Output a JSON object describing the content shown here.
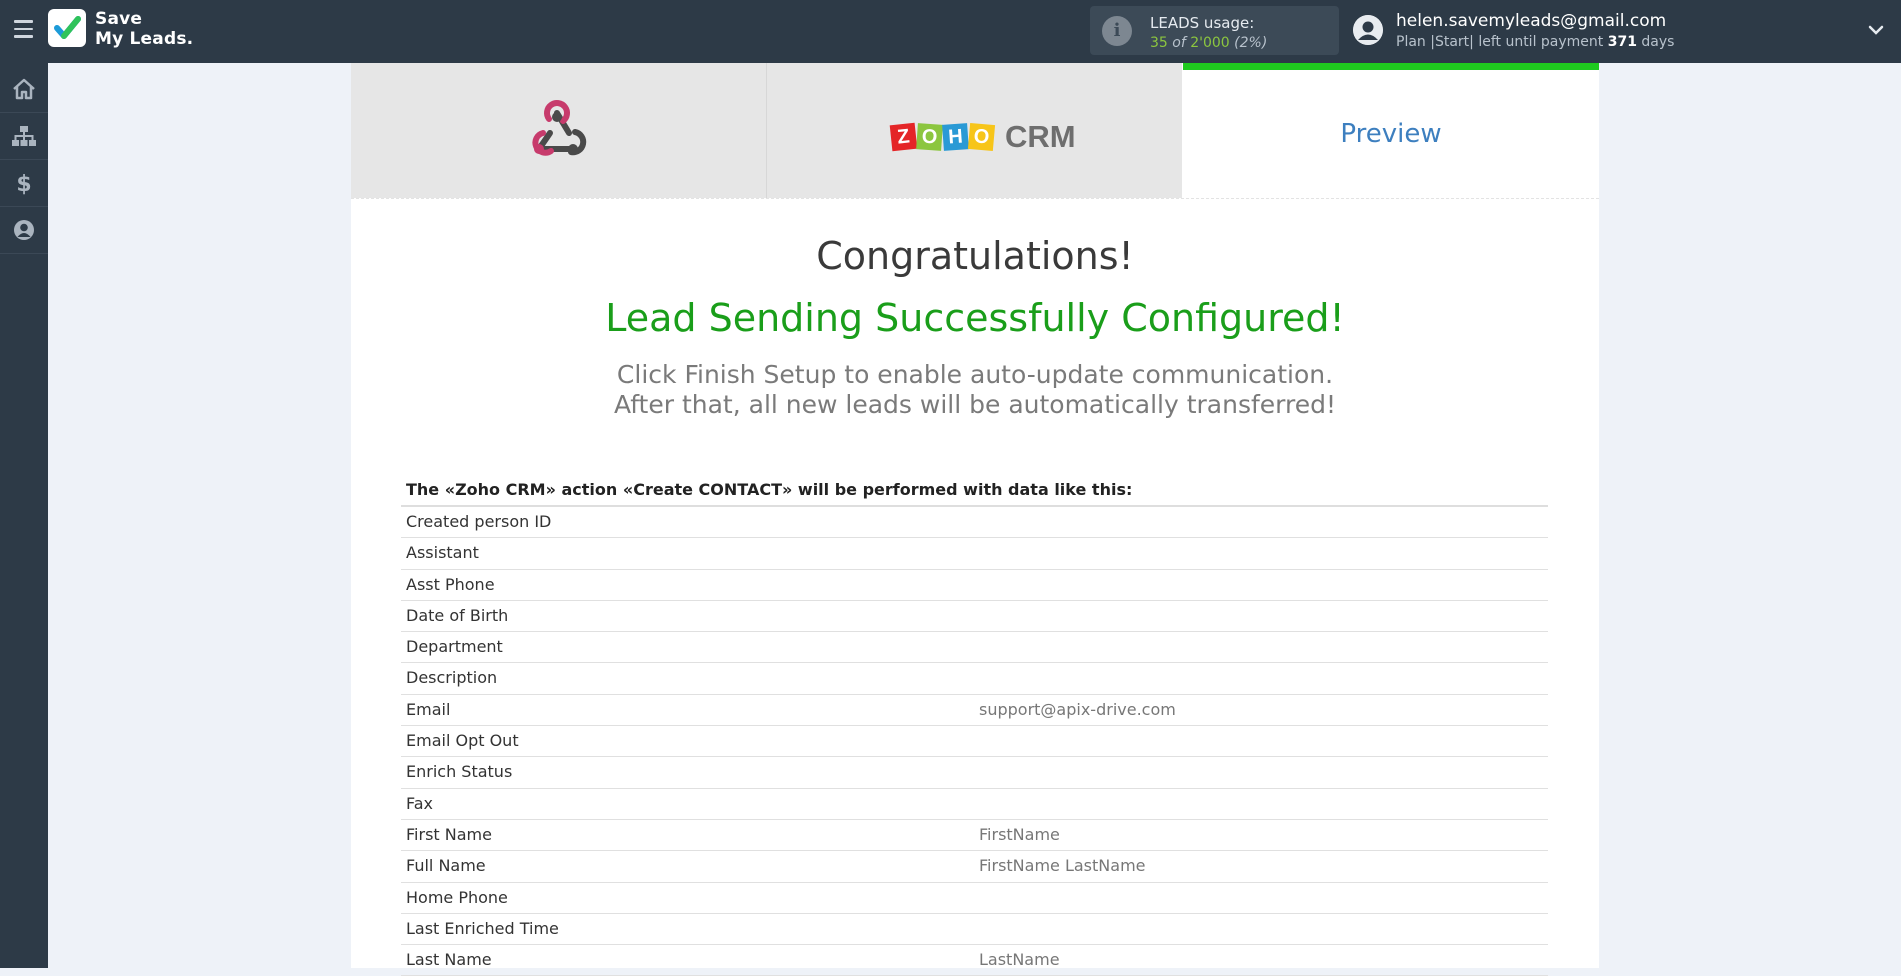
{
  "brand": {
    "name_line1": "Save",
    "name_line2": "My Leads."
  },
  "usage": {
    "title": "LEADS usage:",
    "used": "35",
    "of": "of",
    "total": "2'000",
    "percent": "(2%)"
  },
  "account": {
    "email": "helen.savemyleads@gmail.com",
    "plan_prefix": "Plan |Start| left until payment",
    "days_left": "371",
    "days_suffix": "days"
  },
  "sidebar": {
    "items": [
      "home-icon",
      "sitemap-icon",
      "dollar-icon",
      "user-icon"
    ]
  },
  "steps": {
    "tab2_label": "CRM",
    "tab3_label": "Preview"
  },
  "zoho_letters": [
    "Z",
    "O",
    "H",
    "O"
  ],
  "content": {
    "congrats": "Congratulations!",
    "success": "Lead Sending Successfully Configured!",
    "sub_line1": "Click Finish Setup to enable auto-update communication.",
    "sub_line2": "After that, all new leads will be automatically transferred!"
  },
  "table": {
    "header": "The «Zoho CRM» action «Create CONTACT» will be performed with data like this:",
    "rows": [
      {
        "field": "Created person ID",
        "value": ""
      },
      {
        "field": "Assistant",
        "value": ""
      },
      {
        "field": "Asst Phone",
        "value": ""
      },
      {
        "field": "Date of Birth",
        "value": ""
      },
      {
        "field": "Department",
        "value": ""
      },
      {
        "field": "Description",
        "value": ""
      },
      {
        "field": "Email",
        "value": "support@apix-drive.com"
      },
      {
        "field": "Email Opt Out",
        "value": ""
      },
      {
        "field": "Enrich Status",
        "value": ""
      },
      {
        "field": "Fax",
        "value": ""
      },
      {
        "field": "First Name",
        "value": "FirstName"
      },
      {
        "field": "Full Name",
        "value": "FirstName LastName"
      },
      {
        "field": "Home Phone",
        "value": ""
      },
      {
        "field": "Last Enriched Time",
        "value": ""
      },
      {
        "field": "Last Name",
        "value": "LastName"
      }
    ]
  },
  "colors": {
    "accent_green": "#1fca1f",
    "success_text": "#1a9e1a",
    "link_blue": "#3d7fbf",
    "topbar": "#2d3a47"
  }
}
